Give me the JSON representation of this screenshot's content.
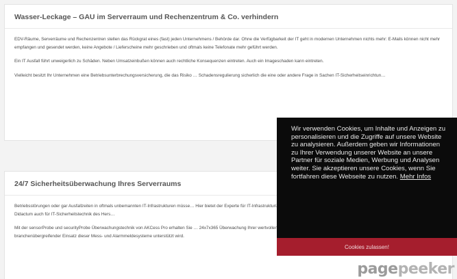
{
  "card1": {
    "title": "Wasser-Leckage – GAU im Serverraum und Rechenzentrum & Co. verhindern",
    "paragraphs": [
      "EDV-Räume, Serverräume und Rechenzentren stellen das Rückgrat eines (fast) jeden Unternehmens / Behörde dar. Ohne die Verfügbarkeit der IT geht in modernen Unternehmen nichts mehr: E-Mails können nicht mehr empfangen und gesendet werden, keine Angebote / Lieferscheine mehr geschrieben und oftmals keine Telefonate mehr geführt werden.",
      "Ein IT Ausfall führt unweigerlich zu Schäden. Neben Umsatzeinbußen können auch rechtliche Konsequenzen eintreten. Auch ein Imageschaden kann eintreten.",
      "Vielleicht besitzt Ihr Unternehmen eine Betriebsunterbrechungsversicherung, die das Risiko … Schadensregulierung sicherlich die eine oder andere Frage in Sachen IT-Sicherheitseinrichtun…"
    ]
  },
  "card2": {
    "title": "24/7 Sicherheitsüberwachung Ihres Serverraums",
    "paragraphs": [
      "Betriebsstörungen oder gar Ausfallzeiten in oftmals unbemannten IT-Infrastrukturen müsse… Hier bietet der Experte für IT-Infrastrukturüberwachung, die Firma Didactum Security GmbH … setzt der AKCP Direktimporteur Didactum auch für IT-Sicherheitstechnik des Hers…",
      "Mit der sensorProbe und securityProbe Überwachungstechnik von AKCess Pro erhalten Sie … 24x7x365 Überwachung Ihrer wertvollen Infrastruktur. Diese Systeme können mit individuell … bestückt werden, so dass ein branchenübergreifender Einsatz dieser Mess- und Alarmmeldesysteme unterstützt wird."
    ]
  },
  "cookie": {
    "text": "Wir verwenden Cookies, um Inhalte und Anzeigen zu personalisieren und die Zugriffe auf unsere Website zu analysieren. Außerdem geben wir Informationen zu Ihrer Verwendung unserer Website an unsere Partner für soziale Medien, Werbung und Analysen weiter. Sie akzeptieren unsere Cookies, wenn Sie fortfahren diese Webseite zu nutzen.",
    "link_label": "Mehr Infos",
    "accept_label": "Cookies zulassen!"
  },
  "watermark": {
    "part1": "page",
    "part2": "peeker"
  }
}
